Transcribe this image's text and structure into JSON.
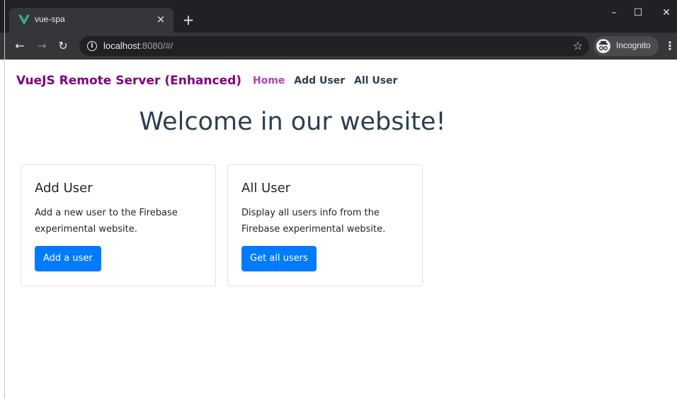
{
  "browser": {
    "tab_title": "vue-spa",
    "tab_close": "×",
    "new_tab": "+",
    "url_host": "localhost",
    "url_rest": ":8080/#/",
    "incognito_label": "Incognito",
    "window_controls": [
      "–",
      "☐",
      "✕"
    ],
    "icons": {
      "back": "arrow-left-icon",
      "forward": "arrow-right-icon",
      "reload": "reload-icon",
      "info": "info-icon",
      "star": "star-icon",
      "menu": "more-vert-icon"
    }
  },
  "navbar": {
    "brand": "VueJS Remote Server (Enhanced)",
    "links": [
      "Home",
      "Add User",
      "All User"
    ],
    "brand_color": "#800080",
    "active_color": "#b03fb2"
  },
  "main": {
    "heading": "Welcome in our website!",
    "cards": [
      {
        "title": "Add User",
        "text": "Add a new user to the Firebase experimental website.",
        "button": "Add a user"
      },
      {
        "title": "All User",
        "text": "Display all users info from the Firebase experimental website.",
        "button": "Get all users"
      }
    ],
    "button_color": "#007bff"
  }
}
